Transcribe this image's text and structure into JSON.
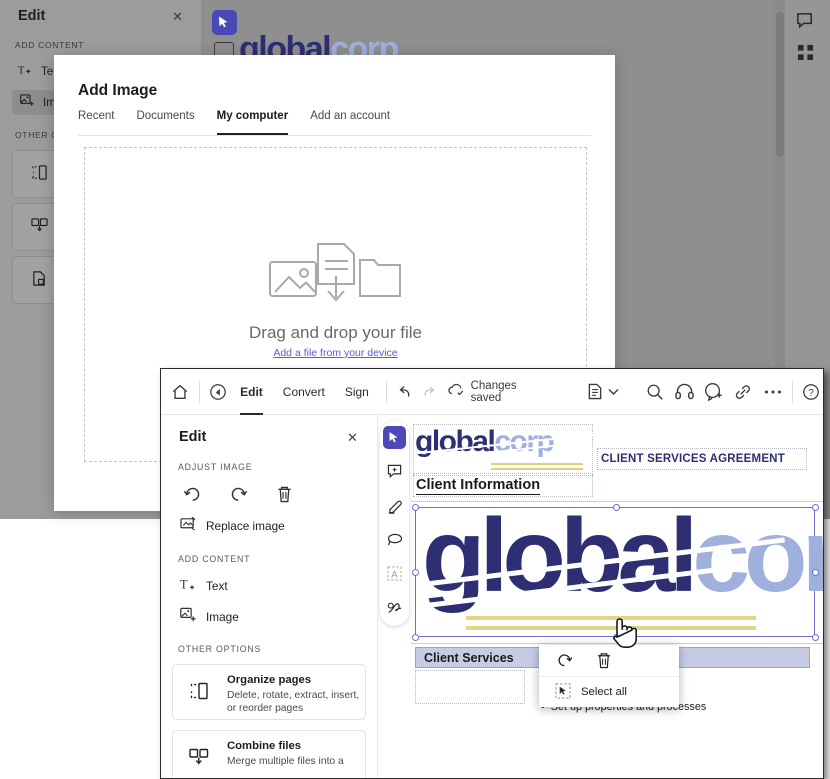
{
  "background_app": {
    "panel": {
      "title": "Edit",
      "close_icon": "close-icon"
    },
    "sections": {
      "add_content": "ADD CONTENT",
      "other_options": "OTHER O"
    },
    "items": [
      {
        "label": "Te",
        "icon": "add-text-icon"
      },
      {
        "label": "Im",
        "icon": "add-image-icon"
      }
    ],
    "cards": [
      {
        "icon": "organize-pages-icon"
      },
      {
        "icon": "combine-files-icon"
      },
      {
        "icon": "compress-file-icon"
      }
    ],
    "document_logo": {
      "part1": "global",
      "part2": "corp"
    },
    "right_rail_icons": [
      "comment-icon",
      "apps-grid-icon"
    ]
  },
  "add_image_dialog": {
    "title": "Add Image",
    "tabs": [
      {
        "label": "Recent",
        "active": false
      },
      {
        "label": "Documents",
        "active": false
      },
      {
        "label": "My computer",
        "active": true
      },
      {
        "label": "Add an account",
        "active": false
      }
    ],
    "dropzone": {
      "icons": [
        "image-icon",
        "document-download-icon",
        "folder-icon"
      ],
      "title": "Drag and drop your file",
      "link": "Add a file from your device"
    }
  },
  "front_window": {
    "toolbar": {
      "home_icon": "home-icon",
      "back_icon": "circle-back-icon",
      "menus": [
        {
          "label": "Edit",
          "active": true
        },
        {
          "label": "Convert",
          "active": false
        },
        {
          "label": "Sign",
          "active": false
        }
      ],
      "undo_icon": "undo-icon",
      "redo_icon": "redo-icon",
      "save_status": "Changes saved",
      "save_icon": "cloud-check-icon",
      "right_icons": [
        "page-thumbnails-icon",
        "chevron-down-icon",
        "search-icon",
        "read-aloud-icon",
        "add-comment-icon",
        "link-icon",
        "more-options-icon",
        "help-icon"
      ]
    },
    "edit_panel": {
      "title": "Edit",
      "close_icon": "close-icon",
      "adjust_image": {
        "section": "ADJUST IMAGE",
        "icons": [
          {
            "name": "rotate-left-icon"
          },
          {
            "name": "rotate-right-icon"
          },
          {
            "name": "delete-icon"
          }
        ],
        "replace_label": "Replace image",
        "replace_icon": "replace-image-icon"
      },
      "add_content": {
        "section": "ADD CONTENT",
        "items": [
          {
            "label": "Text",
            "icon": "add-text-icon"
          },
          {
            "label": "Image",
            "icon": "add-image-icon"
          }
        ]
      },
      "other_options": {
        "section": "OTHER OPTIONS",
        "cards": [
          {
            "title": "Organize pages",
            "desc": "Delete, rotate, extract, insert, or reorder pages",
            "icon": "organize-pages-icon"
          },
          {
            "title": "Combine files",
            "desc": "Merge multiple files into a",
            "icon": "combine-files-icon"
          }
        ]
      }
    },
    "vertical_tools": [
      {
        "name": "select-tool",
        "active": true
      },
      {
        "name": "comment-tool",
        "active": false
      },
      {
        "name": "highlight-tool",
        "active": false
      },
      {
        "name": "draw-lasso-tool",
        "active": false
      },
      {
        "name": "text-select-tool",
        "active": false
      },
      {
        "name": "sign-tool",
        "active": false
      }
    ],
    "document": {
      "logo": {
        "part1": "global",
        "part2": "corp"
      },
      "agreement_title": "CLIENT SERVICES AGREEMENT",
      "heading": "Client Information",
      "selected_image_logo": {
        "part1": "global",
        "part2": "corp"
      },
      "table_header": "Client Services",
      "bullet_text": "Set up properties and processes"
    },
    "context_menu": {
      "rotate_icon": "rotate-right-icon",
      "delete_icon": "delete-icon",
      "select_all_label": "Select all",
      "select_all_icon": "select-all-icon"
    },
    "cursor_icon": "hand-pointer-cursor"
  },
  "colors": {
    "accent_purple": "#4a49b5",
    "logo_dark": "#2e2e73",
    "logo_light": "#9fb0dd",
    "link_blue": "#5a5ad0",
    "table_header_bg": "#c6cce4",
    "selection_border": "#6f6fd0"
  }
}
